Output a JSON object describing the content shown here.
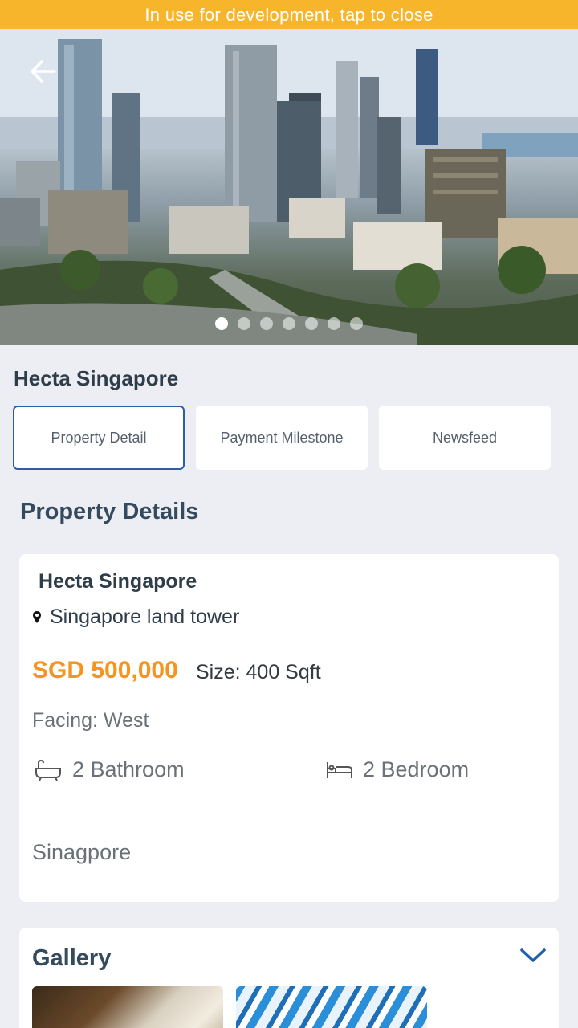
{
  "banner": {
    "text": "In use for development, tap to close"
  },
  "hero": {
    "slide_count": 7,
    "active_slide": 1
  },
  "project": {
    "title": "Hecta Singapore"
  },
  "tabs": [
    {
      "label": "Property Detail",
      "active": true
    },
    {
      "label": "Payment Milestone",
      "active": false
    },
    {
      "label": "Newsfeed",
      "active": false
    }
  ],
  "details": {
    "section_title": "Property Details",
    "name": "Hecta Singapore",
    "location": "Singapore land tower",
    "price": "SGD 500,000",
    "size": "Size: 400 Sqft",
    "facing": "Facing: West",
    "bathrooms": "2 Bathroom",
    "bedrooms": "2 Bedroom",
    "city": "Sinagpore"
  },
  "gallery": {
    "title": "Gallery"
  },
  "colors": {
    "banner": "#f7b52b",
    "accent_blue": "#2a5ea8",
    "price_orange": "#f7941d",
    "background": "#eceef3"
  },
  "icons": [
    "arrow-left-icon",
    "map-pin-icon",
    "bathtub-icon",
    "bed-icon",
    "chevron-down-icon"
  ]
}
